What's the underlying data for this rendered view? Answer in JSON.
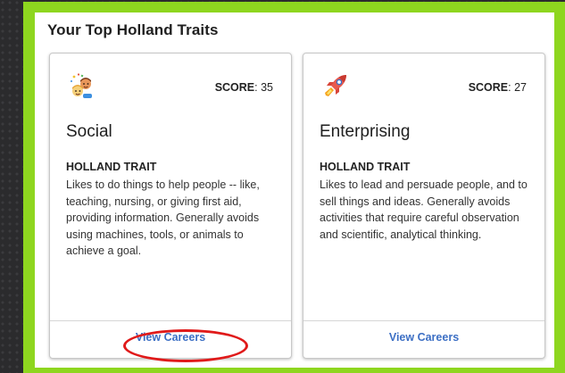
{
  "panel": {
    "title": "Your Top Holland Traits"
  },
  "cards": [
    {
      "icon": "people-celebrating-icon",
      "score_label": "SCORE",
      "score_value": ": 35",
      "name": "Social",
      "trait_label": "HOLLAND TRAIT",
      "description": "Likes to do things to help people -- like, teaching, nursing, or giving first aid, providing information. Generally avoids using machines, tools, or animals to achieve a goal.",
      "link_label": "View Careers"
    },
    {
      "icon": "rocket-icon",
      "score_label": "SCORE",
      "score_value": ": 27",
      "name": "Enterprising",
      "trait_label": "HOLLAND TRAIT",
      "description": "Likes to lead and persuade people, and to sell things and ideas. Generally avoids activities that require careful observation and scientific, analytical thinking.",
      "link_label": "View Careers"
    }
  ],
  "colors": {
    "frame_green": "#8ed61f",
    "link_blue": "#3c6fc4",
    "annotation_red": "#e01a1a"
  }
}
